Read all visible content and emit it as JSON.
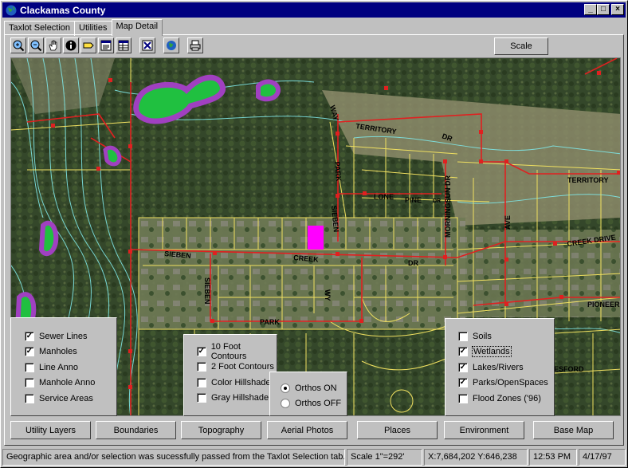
{
  "window": {
    "title": "Clackamas County",
    "controls": {
      "minimize": "_",
      "maximize": "□",
      "close": "×"
    }
  },
  "tabs": [
    {
      "label": "Taxlot Selection",
      "active": false
    },
    {
      "label": "Utilities",
      "active": false
    },
    {
      "label": "Map Detail",
      "active": true
    }
  ],
  "toolbar": {
    "tools": [
      {
        "icon": "zoom-in-icon"
      },
      {
        "icon": "zoom-out-icon"
      },
      {
        "icon": "pan-hand-icon"
      },
      {
        "icon": "info-icon"
      },
      {
        "icon": "label-icon"
      },
      {
        "icon": "identify-list-icon"
      },
      {
        "icon": "table-icon"
      },
      {
        "icon": "clear-selection-icon"
      },
      {
        "icon": "globe-refresh-icon"
      },
      {
        "icon": "print-icon"
      }
    ],
    "scale_label": "Scale"
  },
  "map": {
    "street_labels": [
      "WAY",
      "TERRITORY",
      "DR",
      "PARK",
      "LONE",
      "PINE",
      "DR",
      "MORNINGSUN DR",
      "SIEBEN",
      "AVE",
      "TERRITORY",
      "SIEBEN",
      "CREEK",
      "DR",
      "CREEK DRIVE",
      "SIEBEN",
      "WY",
      "PARK",
      "PIONEER",
      "ILESFORD"
    ]
  },
  "utility_panel": {
    "items": [
      {
        "label": "Sewer Lines",
        "checked": true
      },
      {
        "label": "Manholes",
        "checked": true
      },
      {
        "label": "Line Anno",
        "checked": false
      },
      {
        "label": "Manhole Anno",
        "checked": false
      },
      {
        "label": "Service Areas",
        "checked": false
      }
    ]
  },
  "topo_panel": {
    "items": [
      {
        "label": "10 Foot Contours",
        "checked": true
      },
      {
        "label": "2 Foot Contours",
        "checked": false
      },
      {
        "label": "Color Hillshade",
        "checked": false
      },
      {
        "label": "Gray Hillshade",
        "checked": false
      }
    ]
  },
  "ortho_panel": {
    "options": [
      {
        "label": "Orthos ON",
        "selected": true
      },
      {
        "label": "Orthos OFF",
        "selected": false
      }
    ]
  },
  "environment_panel": {
    "items": [
      {
        "label": "Soils",
        "checked": false
      },
      {
        "label": "Wetlands",
        "checked": true,
        "focused": true
      },
      {
        "label": "Lakes/Rivers",
        "checked": true
      },
      {
        "label": "Parks/OpenSpaces",
        "checked": true
      },
      {
        "label": "Flood Zones ('96)",
        "checked": false
      }
    ]
  },
  "bottom_buttons": [
    "Utility Layers",
    "Boundaries",
    "Topography",
    "Aerial Photos",
    "Places",
    "Environment",
    "Base Map"
  ],
  "status": {
    "message": "Geographic area and/or selection was sucessfully passed from the Taxlot Selection tab.",
    "scale": "Scale 1\"=292'",
    "coords": "X:7,684,202 Y:646,238",
    "time": "12:53 PM",
    "date": "4/17/97"
  },
  "colors": {
    "titlebar": "#000080",
    "parcel_lines": "#f0e060",
    "sewer_lines": "#e02020",
    "contours": "#7fe6e6",
    "wetlands_fill": "#20c040",
    "wetlands_edge": "#a040c0",
    "selected_parcel": "#ff00ff"
  }
}
